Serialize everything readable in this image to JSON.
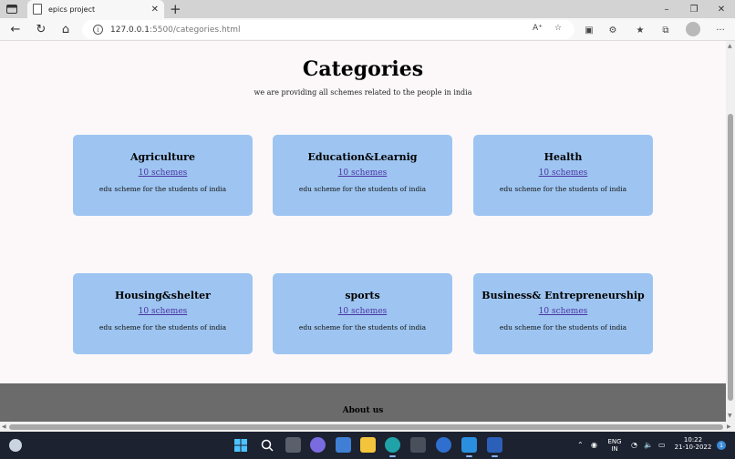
{
  "browser": {
    "tab_title": "epics project",
    "tab_close": "✕",
    "new_tab": "+",
    "url_host": "127.0.0.1",
    "url_path": ":5500/categories.html",
    "more_menu": "···"
  },
  "page": {
    "title": "Categories",
    "subtitle": "we are providing all schemes related to the people in india",
    "categories": [
      {
        "title": "Agriculture",
        "link": "10 schemes",
        "desc": "edu scheme for the students of india"
      },
      {
        "title": "Education&Learnig",
        "link": "10 schemes",
        "desc": "edu scheme for the students of india"
      },
      {
        "title": "Health",
        "link": "10 schemes",
        "desc": "edu scheme for the students of india"
      },
      {
        "title": "Housing&shelter",
        "link": "10 schemes",
        "desc": "edu scheme for the students of india"
      },
      {
        "title": "sports",
        "link": "10 schemes",
        "desc": "edu scheme for the students of india"
      },
      {
        "title": "Business& Entrepreneurship",
        "link": "10 schemes",
        "desc": "edu scheme for the students of india"
      }
    ],
    "footer_title": "About us"
  },
  "taskbar": {
    "lang_1": "ENG",
    "lang_2": "IN",
    "time": "10:22",
    "date": "21-10-2022",
    "notifications": "1"
  },
  "colors": {
    "card": "#9ec5f1",
    "link": "#4b34a3",
    "footer": "#6b6b6b"
  }
}
